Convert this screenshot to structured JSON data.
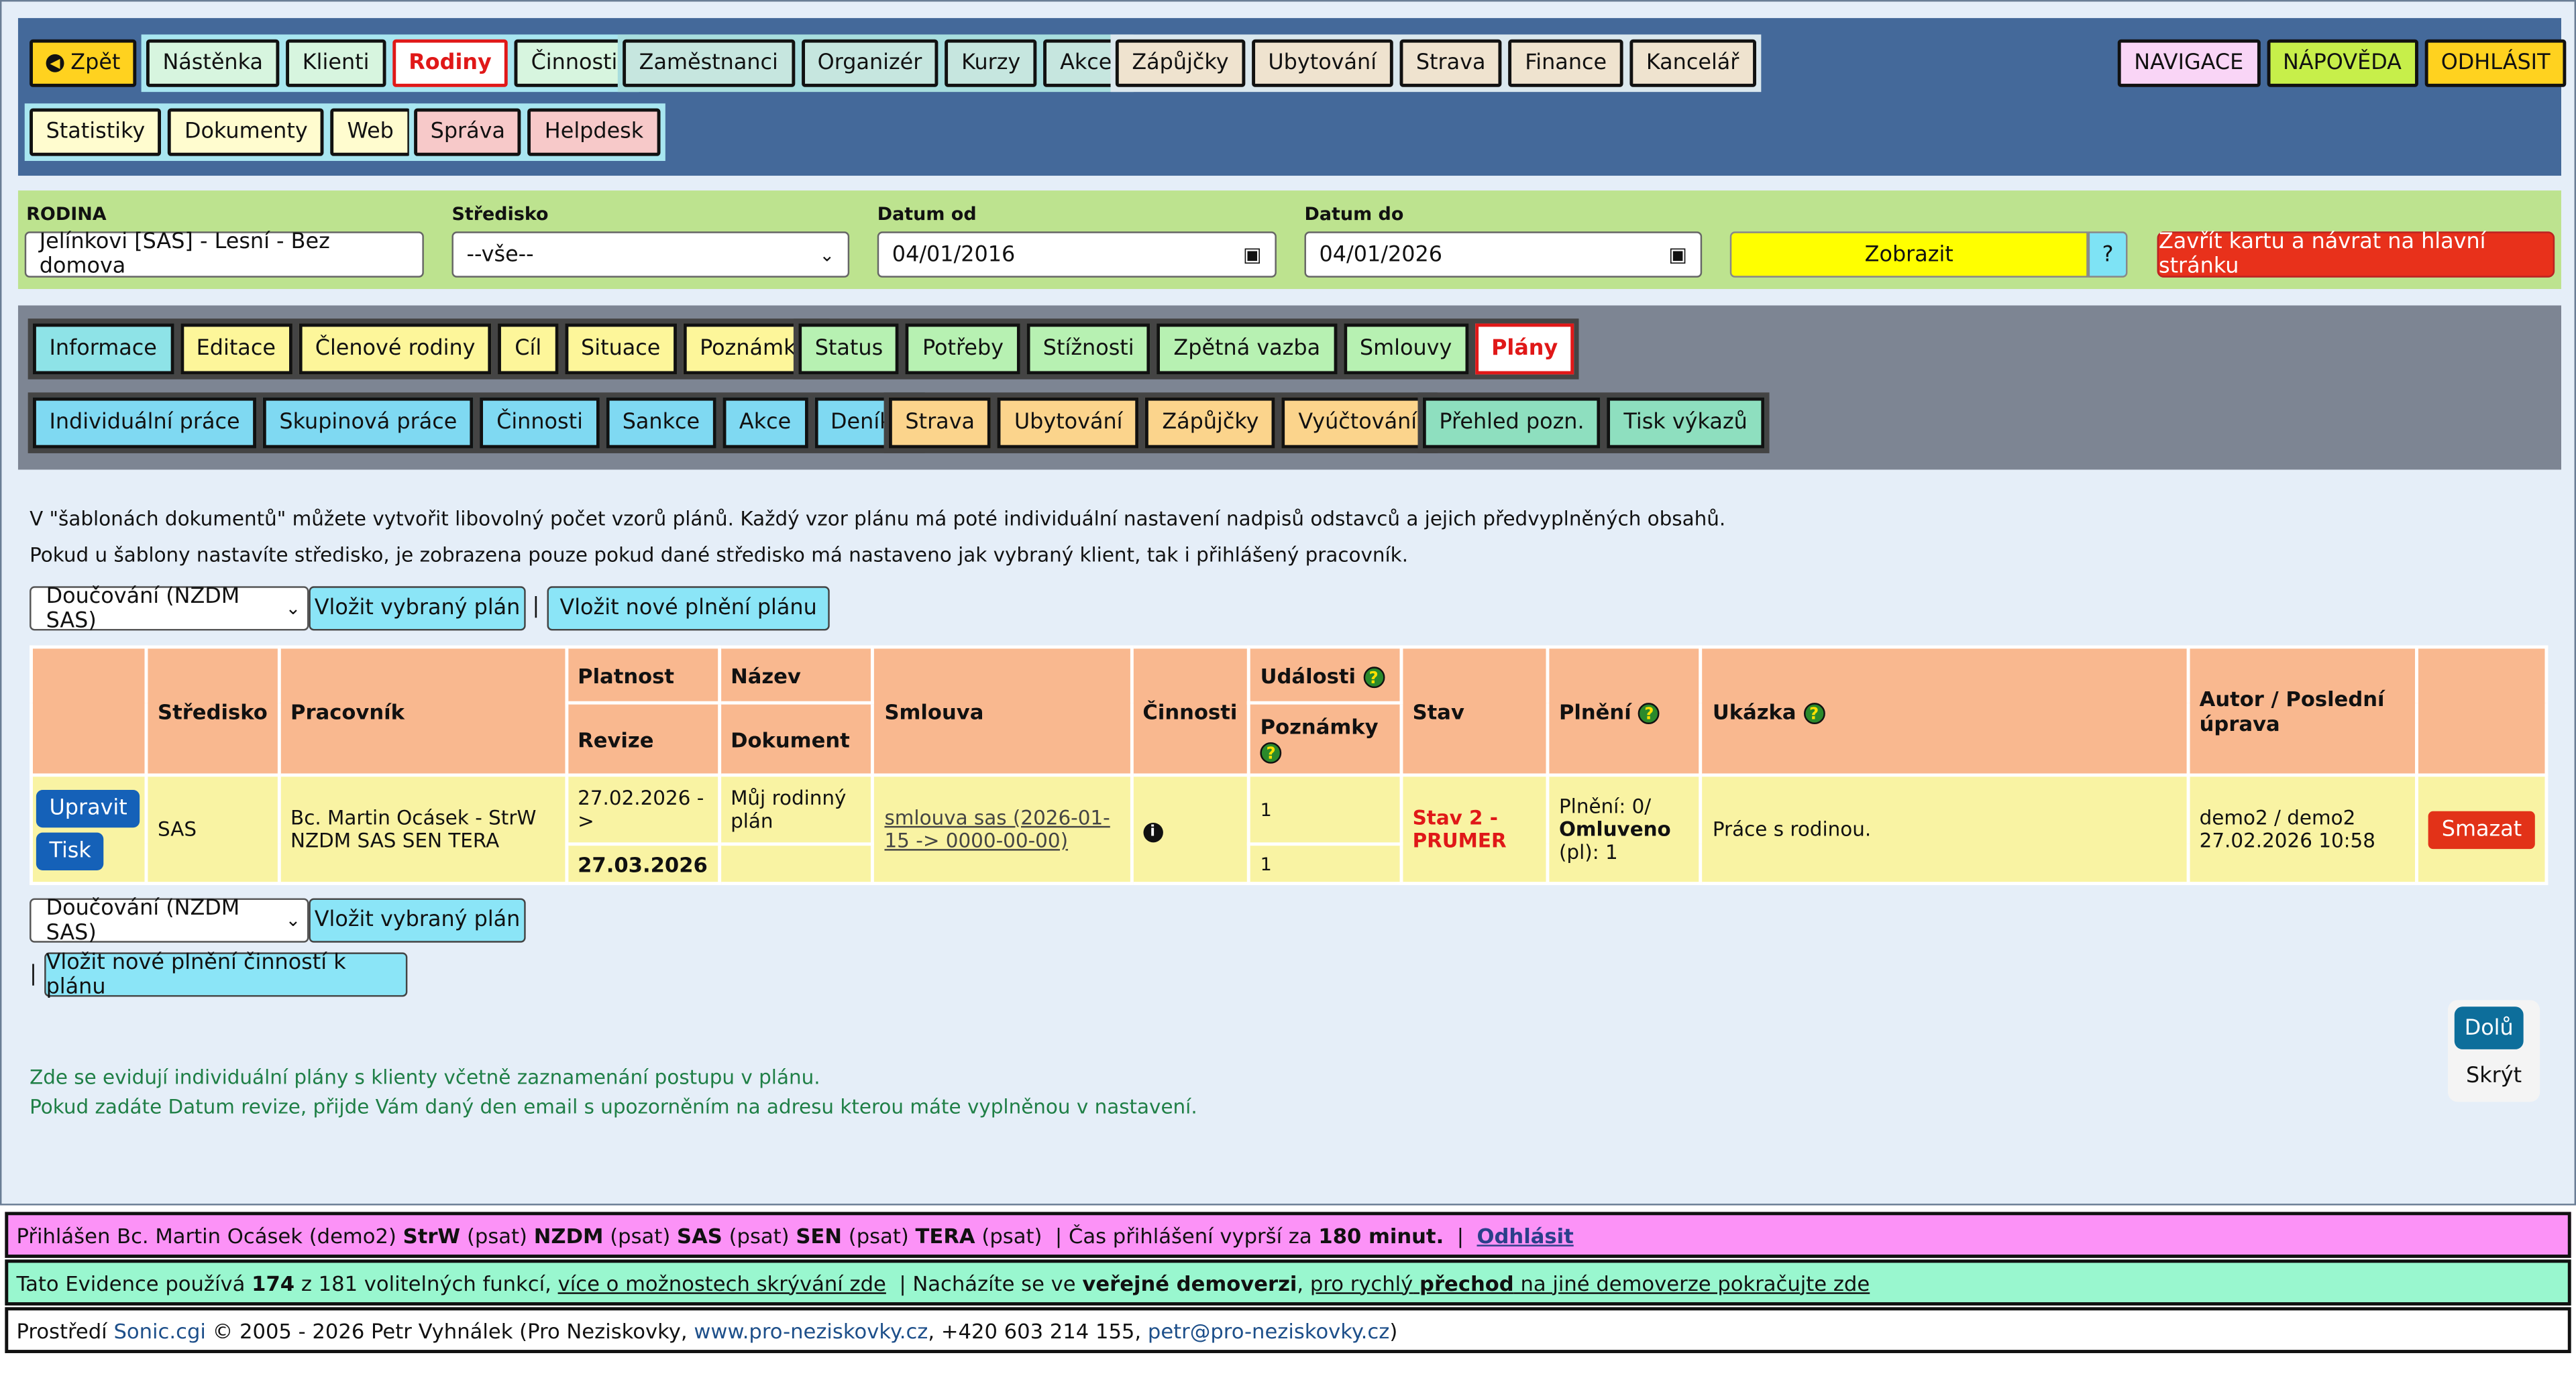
{
  "topnav": {
    "back": "Zpět",
    "group1": [
      "Nástěnka",
      "Klienti",
      "Rodiny",
      "Činnosti"
    ],
    "group2": [
      "Zaměstnanci",
      "Organizér",
      "Kurzy",
      "Akce"
    ],
    "group3": [
      "Zápůjčky",
      "Ubytování",
      "Strava",
      "Finance",
      "Kancelář"
    ],
    "group4": [
      "Statistiky",
      "Dokumenty",
      "Web"
    ],
    "group5": [
      "Správa",
      "Helpdesk"
    ],
    "navigace": "NAVIGACE",
    "napoveda": "NÁPOVĚDA",
    "odhlasit": "ODHLÁSIT"
  },
  "filter": {
    "rodina_label": "RODINA",
    "rodina_value": "Jelínkovi [SAS] - Lesní - Bez domova",
    "stredisko_label": "Středisko",
    "stredisko_value": "--vše--",
    "od_label": "Datum od",
    "od_value": "04/01/2016",
    "do_label": "Datum do",
    "do_value": "04/01/2026",
    "show": "Zobrazit",
    "help": "?",
    "close": "Zavřít kartu a návrat na hlavní stránku"
  },
  "subnav": {
    "r1g1": [
      "Informace",
      "Editace",
      "Členové rodiny",
      "Cíl",
      "Situace",
      "Poznámky"
    ],
    "r1g2": [
      "Status",
      "Potřeby",
      "Stížnosti",
      "Zpětná vazba",
      "Smlouvy",
      "Plány"
    ],
    "r2g1": [
      "Individuální práce",
      "Skupinová práce",
      "Činnosti",
      "Sankce",
      "Akce",
      "Deníky"
    ],
    "r2g2": [
      "Strava",
      "Ubytování",
      "Zápůjčky",
      "Vyúčtování"
    ],
    "r2g3": [
      "Přehled pozn.",
      "Tisk výkazů"
    ]
  },
  "content": {
    "info1": "V \"šablonách dokumentů\" můžete vytvořit libovolný počet vzorů plánů. Každý vzor plánu má poté individuální nastavení nadpisů odstavců a jejich předvyplněných obsahů.",
    "info2": "Pokud u šablony nastavíte středisko, je zobrazena pouze pokud dané středisko má nastaveno jak vybraný klient, tak i přihlášený pracovník.",
    "plan_select": "Doučování (NZDM SAS)",
    "insert_plan": "Vložit vybraný plán",
    "sep": "|",
    "insert_new": "Vložit nové plnění plánu",
    "insert_activity": "Vložit nové plnění činností k plánu",
    "help1": "Zde se evidují individuální plány s klienty včetně zaznamenání postupu v plánu.",
    "help2": "Pokud zadáte Datum revize, přijde Vám daný den email s upozorněním na adresu kterou máte vyplněnou v nastavení."
  },
  "table": {
    "headers": {
      "stredisko": "Středisko",
      "pracovnik": "Pracovník",
      "platnost": "Platnost",
      "revize": "Revize",
      "nazev": "Název",
      "dokument": "Dokument",
      "smlouva": "Smlouva",
      "cinnosti": "Činnosti",
      "udalosti": "Události",
      "poznamky": "Poznámky",
      "stav": "Stav",
      "plneni": "Plnění",
      "ukazka": "Ukázka",
      "autor": "Autor / Poslední úprava"
    },
    "row": {
      "edit": "Upravit",
      "print": "Tisk",
      "stredisko": "SAS",
      "pracovnik": "Bc. Martin Ocásek - StrW NZDM SAS SEN TERA",
      "platnost": "27.02.2026 ->",
      "revize": "27.03.2026",
      "nazev": "Můj rodinný plán",
      "smlouva": "smlouva sas (2026-01-15 -> 0000-00-00)",
      "udalosti": "1",
      "poznamky": "1",
      "stav": "Stav 2 - PRUMER",
      "plneni_line1": "Plnění: 0/",
      "plneni_bold": "Omluveno",
      "plneni_line3": "(pl): 1",
      "ukazka": "Práce s rodinou.",
      "autor": "demo2 / demo2",
      "upraveno": "27.02.2026 10:58",
      "delete": "Smazat"
    }
  },
  "side": {
    "down": "Dolů",
    "hide": "Skrýt"
  },
  "footer": {
    "l1_a": "Přihlášen Bc. Martin Ocásek (demo2)",
    "l1_strw": "StrW",
    "l1_psat": "(psat)",
    "l1_nzdm": "NZDM",
    "l1_sas": "SAS",
    "l1_sen": "SEN",
    "l1_tera": "TERA",
    "l1_cas": "|  Čas přihlášení vyprší za",
    "l1_min": "180 minut.",
    "l1_sep": "|",
    "l1_logout": "Odhlásit",
    "l2_a": "Tato Evidence používá",
    "l2_count": "174",
    "l2_b": "z 181 volitelných funkcí,",
    "l2_link1": "více o možnostech skrývání zde",
    "l2_c": "|  Nacházíte se ve",
    "l2_bold": "veřejné demoverzi",
    "l2_d": ",",
    "l2_link2a": "pro rychlý",
    "l2_link2b": "přechod",
    "l2_link2c": "na jiné demoverze pokračujte zde",
    "l3_a": "Prostředí",
    "l3_sonic": "Sonic.cgi",
    "l3_b": "© 2005 - 2026 Petr Vyhnálek (Pro Neziskovky,",
    "l3_web": "www.pro-neziskovky.cz",
    "l3_c": ", +420 603 214 155,",
    "l3_mail": "petr@pro-neziskovky.cz",
    "l3_d": ")"
  }
}
